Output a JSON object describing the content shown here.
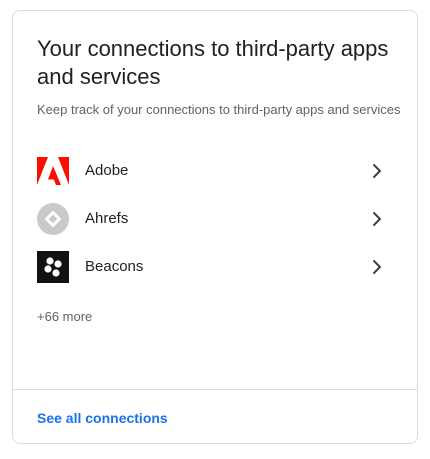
{
  "card": {
    "title": "Your connections to third-party apps and services",
    "subtitle": "Keep track of your connections to third-party apps and services",
    "apps": [
      {
        "name": "Adobe",
        "icon": "adobe-logo-icon",
        "brand_color": "#fa0f00"
      },
      {
        "name": "Ahrefs",
        "icon": "ahrefs-logo-icon",
        "brand_color": "#bdbdbd"
      },
      {
        "name": "Beacons",
        "icon": "beacons-logo-icon",
        "brand_color": "#111111"
      }
    ],
    "more_text": "+66 more",
    "footer_link": "See all connections"
  },
  "colors": {
    "accent": "#1a73e8",
    "text_primary": "#202124",
    "text_secondary": "#5f6368",
    "border": "#dadce0"
  }
}
